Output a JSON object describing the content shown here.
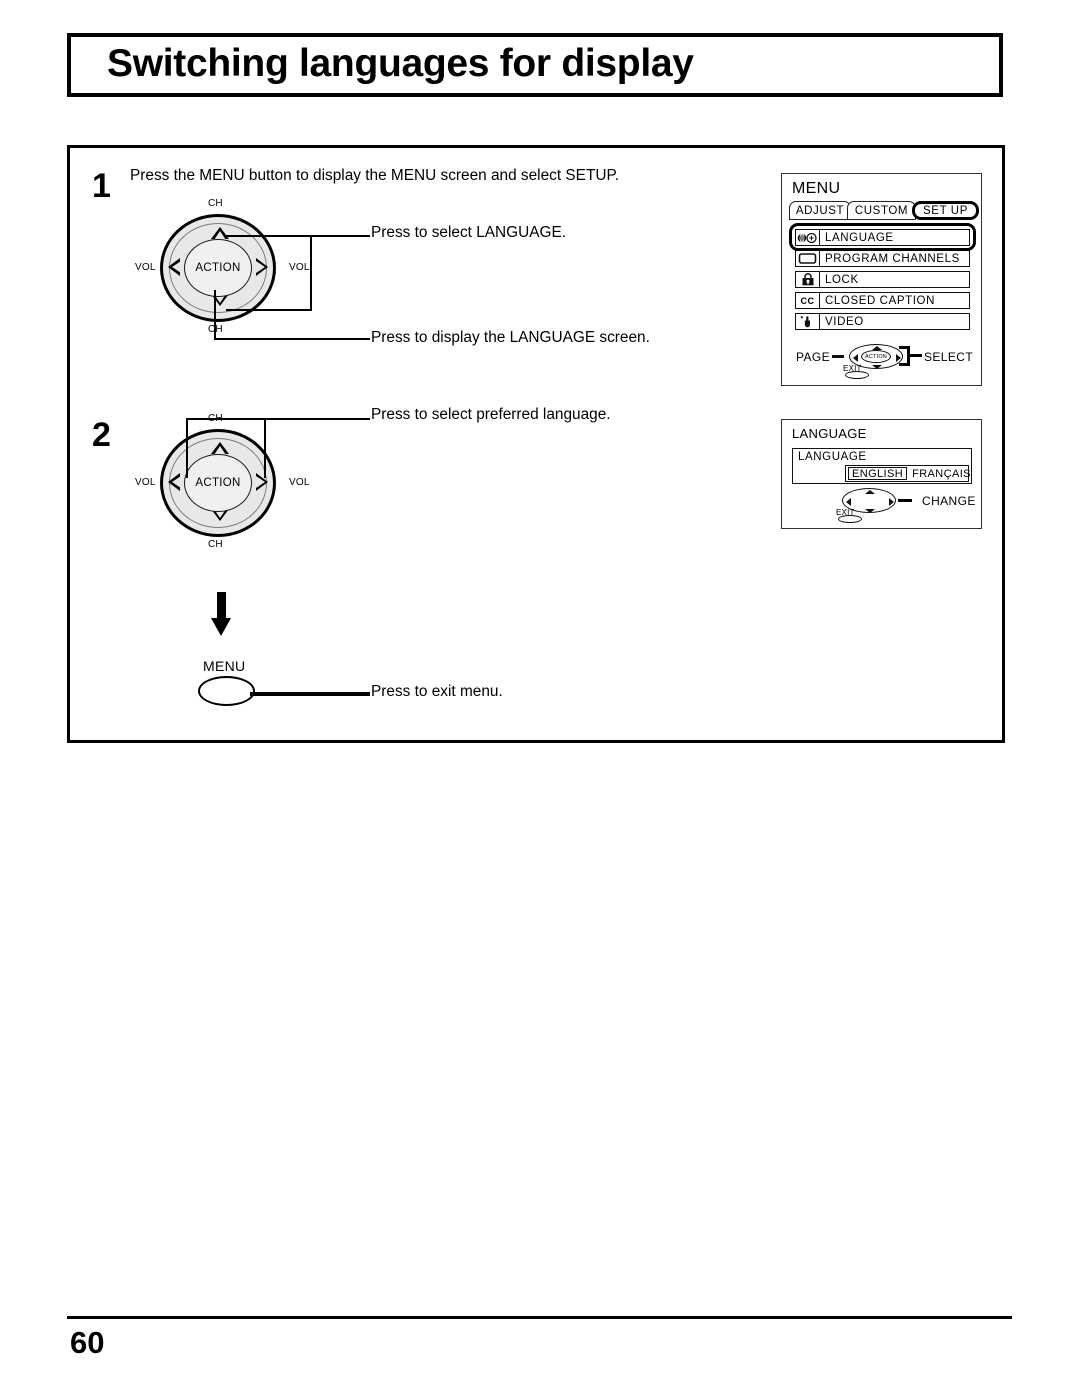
{
  "document": {
    "title": "Switching languages for display",
    "page_number": "60"
  },
  "steps": [
    {
      "number": "1",
      "text": "Press the MENU button to display the MENU screen and select SETUP."
    },
    {
      "number": "2",
      "text": ""
    }
  ],
  "callouts": {
    "select_language": "Press to select LANGUAGE.",
    "display_language_screen": "Press to display the LANGUAGE  screen.",
    "select_preferred_language": "Press to select preferred language.",
    "exit_menu": "Press to exit menu."
  },
  "joypad": {
    "action_label": "ACTION",
    "ch_label": "CH",
    "vol_label": "VOL"
  },
  "menu_button": {
    "label": "MENU"
  },
  "osd_menu": {
    "title": "MENU",
    "tabs": [
      {
        "label": "ADJUST",
        "selected": false
      },
      {
        "label": "CUSTOM",
        "selected": false
      },
      {
        "label": "SET  UP",
        "selected": true
      }
    ],
    "rows": [
      {
        "label": "LANGUAGE",
        "icon": "globe-language-icon",
        "icon_text": "",
        "highlighted": true
      },
      {
        "label": "PROGRAM  CHANNELS",
        "icon": "tv-screen-icon",
        "icon_text": "",
        "highlighted": false
      },
      {
        "label": "LOCK",
        "icon": "padlock-icon",
        "icon_text": "",
        "highlighted": false
      },
      {
        "label": "CLOSED  CAPTION",
        "icon": "closed-caption-icon",
        "icon_text": "CC",
        "highlighted": false
      },
      {
        "label": "VIDEO",
        "icon": "hand-pointer-icon",
        "icon_text": "",
        "highlighted": false
      }
    ],
    "nav": {
      "left_label": "PAGE",
      "right_label": "SELECT",
      "center_label": "ACTION",
      "exit_label": "EXIT"
    }
  },
  "osd_language": {
    "title": "LANGUAGE",
    "inner_title": "LANGUAGE",
    "options": [
      {
        "label": "ENGLISH",
        "selected": true
      },
      {
        "label": "FRANÇAIS",
        "selected": false
      }
    ],
    "nav": {
      "right_label": "CHANGE",
      "exit_label": "EXIT"
    }
  }
}
